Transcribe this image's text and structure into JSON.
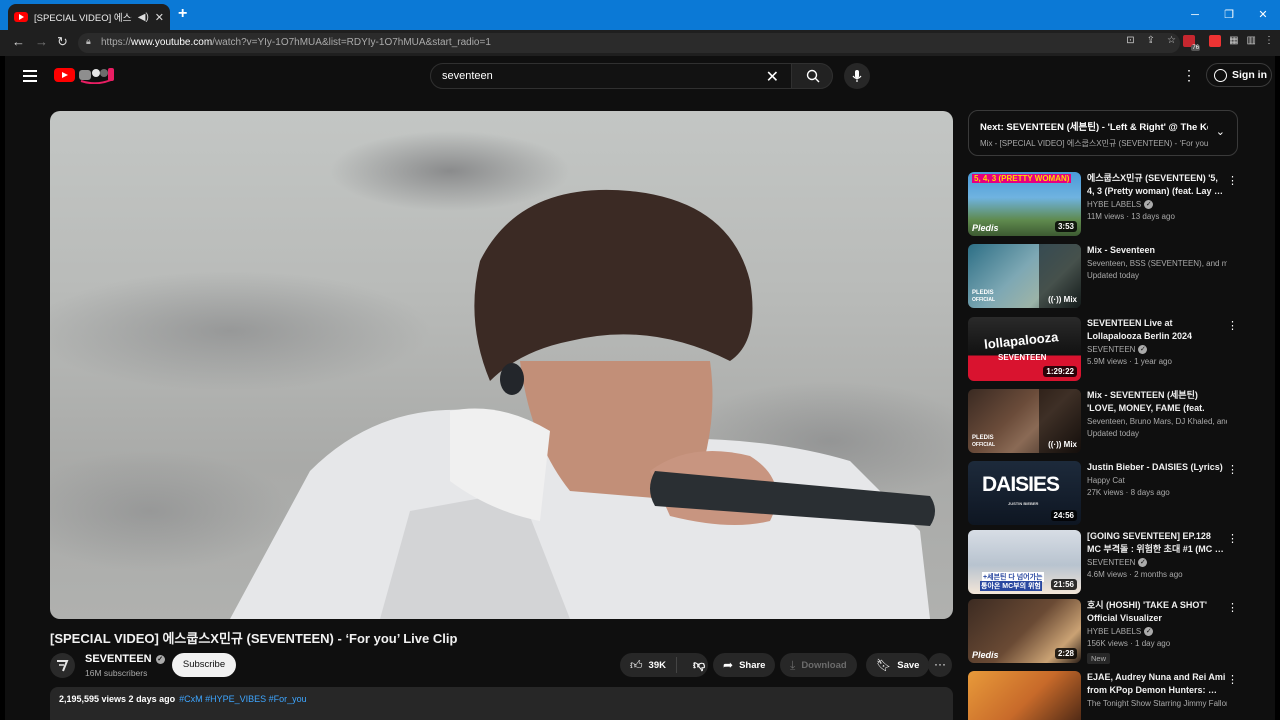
{
  "browser": {
    "tab_title": "[SPECIAL VIDEO] 에스쿱스X",
    "speaker_icon": "speaker-icon",
    "close_glyph": "✕",
    "new_tab_glyph": "+",
    "url_prefix": "https://",
    "url_domain": "www.youtube.com",
    "url_rest": "/watch?v=YIy-1O7hMUA&list=RDYIy-1O7hMUA&start_radio=1",
    "profile_badge": "76"
  },
  "header": {
    "search_query": "seventeen",
    "clear_glyph": "✕",
    "more_glyph": "⋮",
    "signin_label": "Sign in"
  },
  "video": {
    "title": "[SPECIAL VIDEO] 에스쿱스X민규 (SEVENTEEN) - ‘For you’ Live Clip",
    "channel": "SEVENTEEN",
    "subscribers": "16M subscribers",
    "subscribe_label": "Subscribe",
    "likes": "39K",
    "share_label": "Share",
    "download_label": "Download",
    "save_label": "Save",
    "more_glyph": "···",
    "views_date": "2,195,595 views  2 days ago",
    "tags": "#CxM #HYPE_VIBES #For_you"
  },
  "up_next": {
    "title": "Next: SEVENTEEN (세븐틴) - 'Left & Right' @ The Ke…",
    "playlist": "Mix - [SPECIAL VIDEO] 에스쿱스X민규 (SEVENTEEN) - ‘For you"
  },
  "recommendations": [
    {
      "title": "에스쿱스X민규 (SEVENTEEN) '5, 4, 3 (Pretty woman) (feat. Lay …",
      "channel": "HYBE LABELS",
      "verified": true,
      "meta": "11M views · 13 days ago",
      "duration": "3:53",
      "thumb_text": "5, 4, 3 (PRETTY WOMAN)",
      "thumb_sub": "Pledis"
    },
    {
      "title": "Mix - Seventeen",
      "channel": "Seventeen, BSS (SEVENTEEN), and more",
      "verified": false,
      "meta": "Updated today",
      "duration": "Mix",
      "thumb_text": "PLEDIS",
      "thumb_sub": "OFFICIAL"
    },
    {
      "title": "SEVENTEEN Live at Lollapalooza Berlin 2024",
      "channel": "SEVENTEEN",
      "verified": true,
      "meta": "5.9M views · 1 year ago",
      "duration": "1:29:22",
      "thumb_text": "lollapalooza",
      "thumb_sub": "SEVENTEEN"
    },
    {
      "title": "Mix - SEVENTEEN (세븐틴) 'LOVE, MONEY, FAME (feat. DJ…",
      "channel": "Seventeen, Bruno Mars, DJ Khaled, and …",
      "verified": false,
      "meta": "Updated today",
      "duration": "Mix",
      "thumb_text": "PLEDIS",
      "thumb_sub": "OFFICIAL"
    },
    {
      "title": "Justin Bieber - DAISIES (Lyrics)",
      "channel": "Happy Cat",
      "verified": false,
      "meta": "27K views · 8 days ago",
      "duration": "24:56",
      "thumb_text": "DAISIES",
      "thumb_sub": "JUSTIN BIEBER"
    },
    {
      "title": "[GOING SEVENTEEN] EP.128 MC 부격돌 : 위험한 초대 #1 (MC …",
      "channel": "SEVENTEEN",
      "verified": true,
      "meta": "4.6M views · 2 months ago",
      "duration": "21:56",
      "thumb_text": "+세븐틴 다 넘어가는",
      "thumb_sub": "통아온 MC부의 위험"
    },
    {
      "title": "호시 (HOSHI) 'TAKE A SHOT' Official Visualizer",
      "channel": "HYBE LABELS",
      "verified": true,
      "meta": "156K views · 1 day ago",
      "duration": "2:28",
      "badge": "New",
      "thumb_text": "",
      "thumb_sub": "Pledis"
    },
    {
      "title": "EJAE, Audrey Nuna and Rei Ami from KPop Demon Hunters: …",
      "channel": "The Tonight Show Starring Jimmy Fallon",
      "verified": true,
      "meta": "",
      "duration": "",
      "thumb_text": "",
      "thumb_sub": ""
    }
  ]
}
